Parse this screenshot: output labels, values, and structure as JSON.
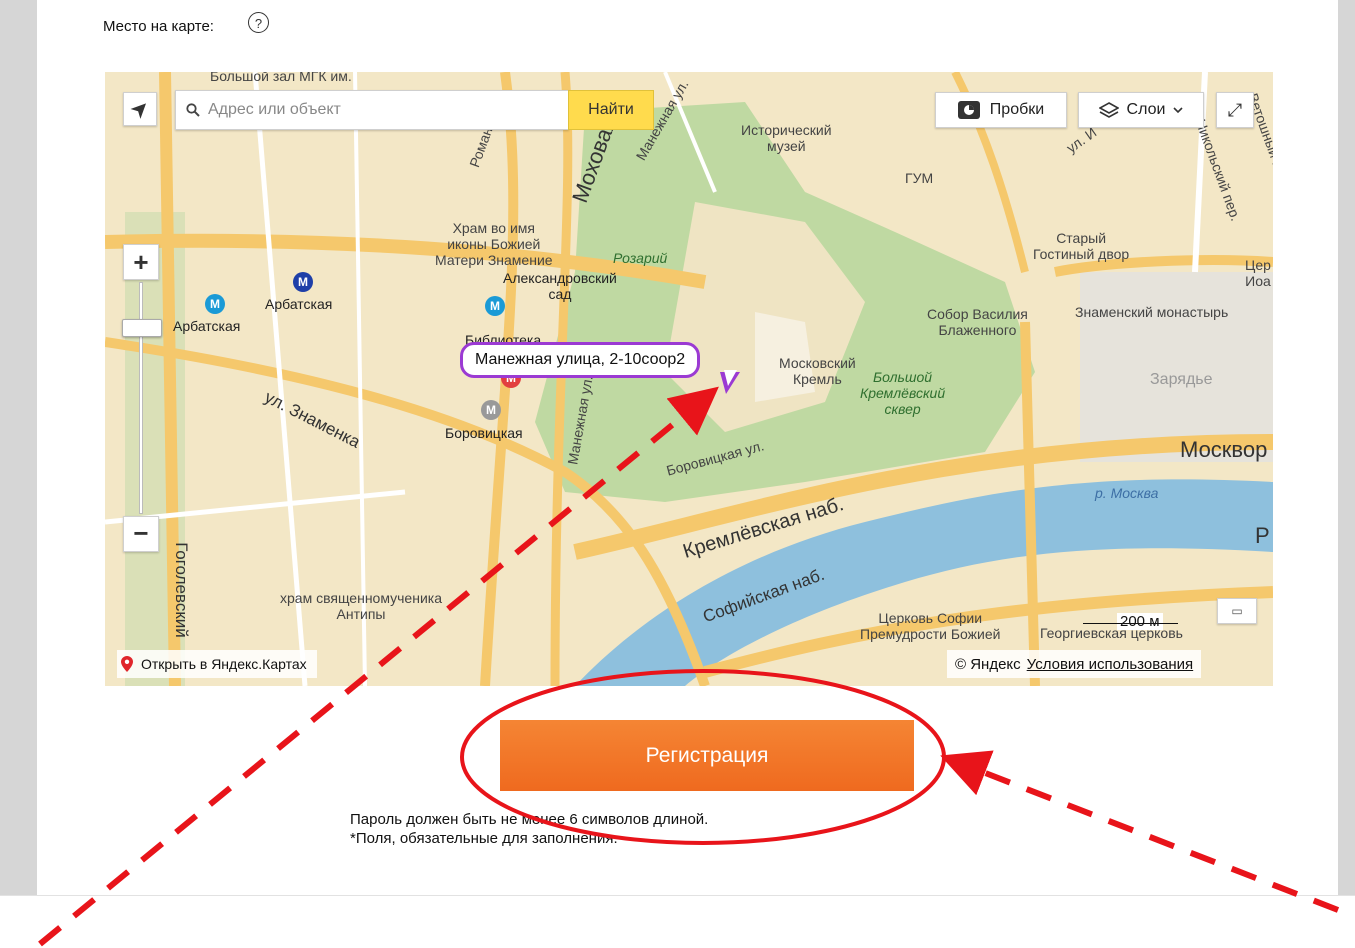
{
  "form": {
    "location_label": "Место на карте:",
    "help_icon": "?"
  },
  "map": {
    "geo_icon": "➤",
    "search_placeholder": "Адрес или объект",
    "find_label": "Найти",
    "traffic_label": "Пробки",
    "layers_label": "Слои",
    "fullscreen_icon": "⤢",
    "zoom_in": "+",
    "zoom_out": "−",
    "balloon_text": "Манежная улица, 2-10соор2",
    "scale_text": "200 м",
    "open_in_yandex": "Открыть в Яндекс.Картах",
    "copyright": "© Яндекс",
    "terms": "Условия использования",
    "labels": {
      "bolshoi_zal": "Большой зал МГК им.",
      "romanov": "Романов",
      "mokhovaya": "Моховая",
      "manezhnaya_ul": "Манежная ул.",
      "historical_museum": "Исторический\nмузей",
      "gum": "ГУМ",
      "il_ul": "ул. И",
      "nikolsky": "Никольский пер.",
      "vetoshny": "Ветошный пер.",
      "temple_znamenie": "Храм во имя\nиконы Божией\nМатери Знамение",
      "rozary": "Розарий",
      "alexander_garden": "Александровский\nсад",
      "old_gostiny": "Старый\nГостиный двор",
      "church_right": "Цер\nИоа",
      "arbatskaya_1": "Арбатская",
      "arbatskaya_2": "Арбатская",
      "biblioteka": "Библиотека",
      "sobor": "Собор Василия\nБлаженного",
      "znamensky": "Знаменский монастырь",
      "kreml": "Московский\nКремль",
      "bolshoi_sq": "Большой\nКремлёвский\nсквер",
      "zaryadye": "Зарядье",
      "manezhnaya_v": "Манежная ул.",
      "znamenka": "ул. Знаменка",
      "borovitskaya": "Боровицкая",
      "borovitskaya_ul": "Боровицкая ул.",
      "moskvor": "Москвор",
      "moscow_river": "р. Москва",
      "kremlevskaya": "Кремлёвская наб.",
      "sofiyskaya": "Софийская наб.",
      "antipy": "храм священномученика\nАнтипы",
      "sofia": "Церковь Софии\nПремудрости Божией",
      "georgievskaya": "Георгиевская церковь",
      "gogolevsky": "Гоголевский",
      "r_label": "Р",
      "metro_m": "М"
    }
  },
  "actions": {
    "register_label": "Регистрация"
  },
  "notes": {
    "password_hint": "Пароль должен быть не менее 6 символов длиной.",
    "required_hint": "*Поля, обязательные для заполнения."
  },
  "colors": {
    "register": "#f07223",
    "annotation": "#e8141a",
    "balloon": "#9b3ad3",
    "river": "#7fb6d6",
    "park": "#b9d79c",
    "road": "#f4c56a"
  }
}
